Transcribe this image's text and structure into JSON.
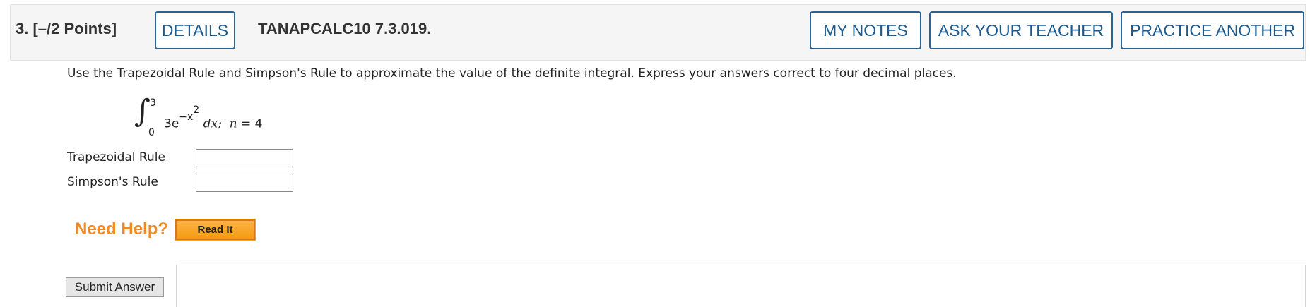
{
  "header": {
    "question_number": "3.",
    "points": "[–/2 Points]",
    "details_label": "DETAILS",
    "assignment_id": "TANAPCALC10 7.3.019.",
    "my_notes_label": "MY NOTES",
    "ask_teacher_label": "ASK YOUR TEACHER",
    "practice_another_label": "PRACTICE ANOTHER"
  },
  "question": {
    "instructions": "Use the Trapezoidal Rule and Simpson's Rule to approximate the value of the definite integral. Express your answers correct to four decimal places.",
    "integral": {
      "upper_limit": "3",
      "lower_limit": "0",
      "coefficient": "3e",
      "exponent": "−x",
      "exponent_power": "2",
      "differential": "dx;",
      "n_label": "n",
      "n_value": "= 4"
    },
    "fields": [
      {
        "label": "Trapezoidal Rule",
        "value": ""
      },
      {
        "label": "Simpson's Rule",
        "value": ""
      }
    ]
  },
  "help": {
    "need_help_label": "Need Help?",
    "read_it_label": "Read It"
  },
  "submit": {
    "label": "Submit Answer"
  },
  "colors": {
    "accent_blue": "#1d5a8e",
    "help_orange": "#f08a24"
  }
}
